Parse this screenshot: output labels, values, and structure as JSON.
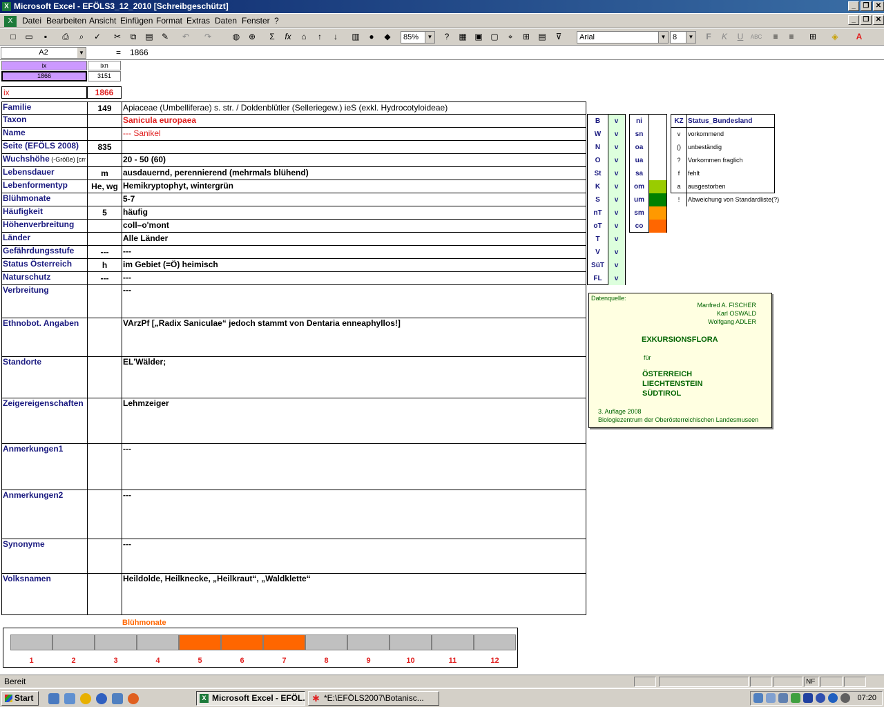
{
  "window": {
    "title": "Microsoft Excel - EFÖLS3_12_2010  [Schreibgeschützt]"
  },
  "menu": [
    "Datei",
    "Bearbeiten",
    "Ansicht",
    "Einfügen",
    "Format",
    "Extras",
    "Daten",
    "Fenster",
    "?"
  ],
  "toolbar": {
    "zoom": "85%",
    "font": "Arial",
    "size": "8"
  },
  "formula": {
    "namebox": "A2",
    "eq": "=",
    "value": "1866"
  },
  "header": {
    "ix_label": "ix",
    "ixn_label": "ixn",
    "ix_val": "1866",
    "ixn_val": "3151"
  },
  "ix": {
    "label": "ix",
    "value": "1866"
  },
  "rows": [
    {
      "label": "Familie",
      "mid": "149",
      "text": "Apiaceae (Umbelliferae) s. str.  /  Doldenblütler (Selleriegew.) ieS (exkl. Hydrocotyloideae)"
    },
    {
      "label": "Taxon",
      "mid": "",
      "text": "Sanicula europaea"
    },
    {
      "label": "Name",
      "mid": "",
      "text": "--- Sanikel"
    },
    {
      "label": "Seite (EFÖLS 2008)",
      "mid": "835",
      "text": ""
    },
    {
      "label": "Wuchshöhe",
      "label_small": " (-Größe) [cm]",
      "mid": "",
      "text": " 20 - 50 (60)"
    },
    {
      "label": "Lebensdauer",
      "mid": "m",
      "text": "ausdauernd, perennierend (mehrmals blühend)"
    },
    {
      "label": "Lebenformentyp",
      "mid": "He, wg",
      "text": "Hemikryptophyt, wintergrün"
    },
    {
      "label": "Blühmonate",
      "mid": "",
      "text": " 5-7"
    },
    {
      "label": "Häufigkeit",
      "mid": "5",
      "text": "häufig"
    },
    {
      "label": "Höhenverbreitung",
      "mid": "",
      "text": "coll–o'mont"
    },
    {
      "label": "Länder",
      "mid": "",
      "text": "Alle Länder"
    },
    {
      "label": "Gefährdungsstufe",
      "mid": "---",
      "text": " ---"
    },
    {
      "label": "Status Österreich",
      "mid": "h",
      "text": "im Gebiet (=Ö) heimisch"
    },
    {
      "label": "Naturschutz",
      "mid": "---",
      "text": " ---"
    }
  ],
  "big_rows": [
    {
      "label": "Verbreitung",
      "text": " ---"
    },
    {
      "label": "Ethnobot. Angaben",
      "text": "VArzPf [„Radix Saniculae“ jedoch stammt von Dentaria enneaphyllos!]"
    },
    {
      "label": "Standorte",
      "text": "EL'Wälder;"
    },
    {
      "label": "Zeigereigenschaften",
      "text": "Lehmzeiger"
    },
    {
      "label": "Anmerkungen1",
      "text": "---"
    },
    {
      "label": "Anmerkungen2",
      "text": "---"
    },
    {
      "label": "Synonyme",
      "text": "---"
    },
    {
      "label": "Volksnamen",
      "text": "Heildolde, Heilknecke, „Heilkraut“, „Waldklette“"
    }
  ],
  "states": [
    {
      "code": "B",
      "v": "v"
    },
    {
      "code": "W",
      "v": "v"
    },
    {
      "code": "N",
      "v": "v"
    },
    {
      "code": "O",
      "v": "v"
    },
    {
      "code": "St",
      "v": "v"
    },
    {
      "code": "K",
      "v": "v"
    },
    {
      "code": "S",
      "v": "v"
    },
    {
      "code": "nT",
      "v": "v"
    },
    {
      "code": "oT",
      "v": "v"
    },
    {
      "code": "T",
      "v": "v"
    },
    {
      "code": "V",
      "v": "v"
    },
    {
      "code": "SüT",
      "v": "v"
    },
    {
      "code": "FL",
      "v": "v"
    }
  ],
  "zones": [
    {
      "code": "ni",
      "color": "#ffffff"
    },
    {
      "code": "sn",
      "color": "#ffffff"
    },
    {
      "code": "oa",
      "color": "#ffffff"
    },
    {
      "code": "ua",
      "color": "#ffffff"
    },
    {
      "code": "sa",
      "color": "#ffffff"
    },
    {
      "code": "om",
      "color": "#99cc00"
    },
    {
      "code": "um",
      "color": "#008000"
    },
    {
      "code": "sm",
      "color": "#ff9900"
    },
    {
      "code": "co",
      "color": "#ff6600"
    }
  ],
  "legend": {
    "kz": "KZ",
    "title": "Status_Bundesland",
    "items": [
      {
        "k": "v",
        "t": "vorkommend"
      },
      {
        "k": "()",
        "t": "unbeständig"
      },
      {
        "k": "?",
        "t": "Vorkommen fraglich"
      },
      {
        "k": "f",
        "t": "fehlt"
      },
      {
        "k": "a",
        "t": "ausgestorben"
      },
      {
        "k": "!",
        "t": "Abweichung von Standardliste(?)"
      }
    ]
  },
  "source": {
    "label": "Datenquelle:",
    "authors": [
      "Manfred A. FISCHER",
      "Karl OSWALD",
      "Wolfgang ADLER"
    ],
    "book": "EXKURSIONSFLORA",
    "fuer": "für",
    "countries": [
      "ÖSTERREICH",
      "LIECHTENSTEIN",
      "SÜDTIROL"
    ],
    "edition": "3. Auflage 2008",
    "publisher": "Biologiezentrum der Oberösterreichischen Landesmuseen"
  },
  "bluete": {
    "title": "Blühmonate",
    "months": [
      "1",
      "2",
      "3",
      "4",
      "5",
      "6",
      "7",
      "8",
      "9",
      "10",
      "11",
      "12"
    ],
    "active": [
      false,
      false,
      false,
      false,
      true,
      true,
      true,
      false,
      false,
      false,
      false,
      false
    ],
    "active_color": "#ff6600",
    "inactive_color": "#c0c0c0"
  },
  "status": {
    "text": "Bereit",
    "nf": "NF"
  },
  "taskbar": {
    "start": "Start",
    "tasks": [
      "Microsoft Excel - EFÖL...",
      "*E:\\EFÖLS2007\\Botanisc..."
    ],
    "clock": "07:20"
  }
}
